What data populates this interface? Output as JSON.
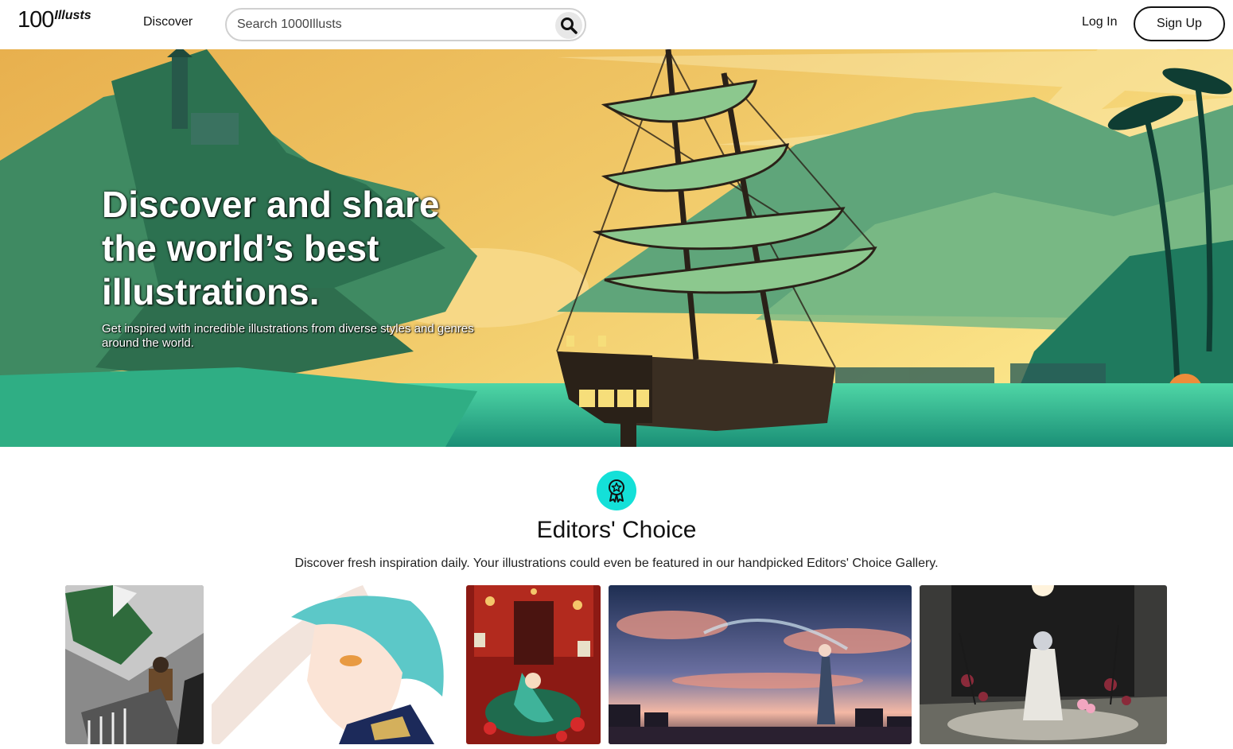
{
  "header": {
    "logo_number": "100",
    "logo_word": "Illusts",
    "nav_discover": "Discover",
    "search_placeholder": "Search 1000Illusts",
    "login_label": "Log In",
    "signup_label": "Sign Up"
  },
  "hero": {
    "title": "Discover and share the world’s best illustrations.",
    "subtitle": "Get inspired with incredible illustrations from diverse styles and genres around the world."
  },
  "editors_choice": {
    "icon": "award-ribbon-icon",
    "title": "Editors' Choice",
    "description": "Discover fresh inspiration daily. Your illustrations could even be featured in our handpicked Editors' Choice Gallery."
  },
  "colors": {
    "accent": "#14e0d8",
    "hero_sky": "#f3c15e",
    "hero_sea": "#33c79a"
  },
  "gallery": [
    {
      "subject": "soldier in green cloak, monochrome"
    },
    {
      "subject": "teal-haired character portrait"
    },
    {
      "subject": "red shrine interior"
    },
    {
      "subject": "twilight sky with figure"
    },
    {
      "subject": "figure in white kimono among flowers"
    }
  ]
}
